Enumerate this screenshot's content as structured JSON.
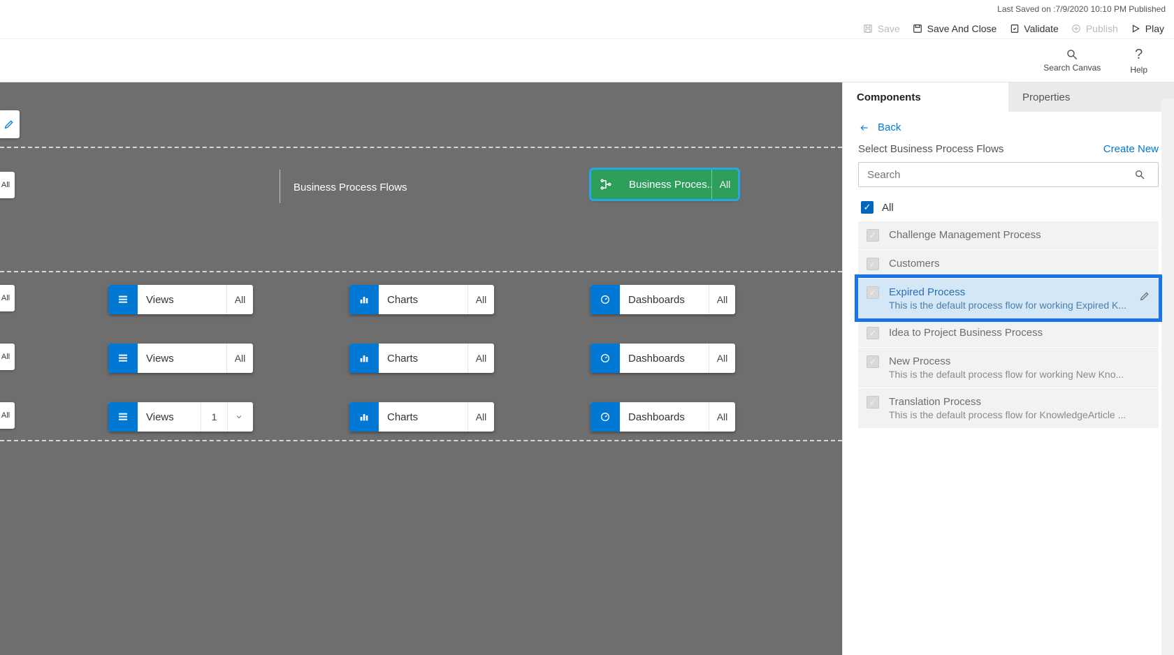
{
  "status": {
    "last_saved": "Last Saved on :7/9/2020 10:10 PM Published"
  },
  "toolbar": {
    "save": "Save",
    "save_close": "Save And Close",
    "validate": "Validate",
    "publish": "Publish",
    "play": "Play"
  },
  "secbar": {
    "search": "Search Canvas",
    "help": "Help"
  },
  "canvas": {
    "bpf_section_label": "Business Process Flows",
    "selected_tile": {
      "label": "Business Proces...",
      "badge": "All"
    },
    "lane_chip": "All",
    "rows": [
      [
        {
          "icon": "grid",
          "label": "Views",
          "badge": "All"
        },
        {
          "icon": "bar",
          "label": "Charts",
          "badge": "All"
        },
        {
          "icon": "gauge",
          "label": "Dashboards",
          "badge": "All"
        }
      ],
      [
        {
          "icon": "grid",
          "label": "Views",
          "badge": "All"
        },
        {
          "icon": "bar",
          "label": "Charts",
          "badge": "All"
        },
        {
          "icon": "gauge",
          "label": "Dashboards",
          "badge": "All"
        }
      ],
      [
        {
          "icon": "grid",
          "label": "Views",
          "badge": "1",
          "chev": true
        },
        {
          "icon": "bar",
          "label": "Charts",
          "badge": "All"
        },
        {
          "icon": "gauge",
          "label": "Dashboards",
          "badge": "All"
        }
      ]
    ]
  },
  "panel": {
    "tabs": {
      "components": "Components",
      "properties": "Properties"
    },
    "back": "Back",
    "title": "Select Business Process Flows",
    "create_new": "Create New",
    "search_placeholder": "Search",
    "all_label": "All",
    "items": [
      {
        "name": "Challenge Management Process"
      },
      {
        "name": "Customers"
      },
      {
        "name": "Expired Process",
        "desc": "This is the default process flow for working Expired K...",
        "highlight": true
      },
      {
        "name": "Idea to Project Business Process"
      },
      {
        "name": "New Process",
        "desc": "This is the default process flow for working New Kno..."
      },
      {
        "name": "Translation Process",
        "desc": "This is the default process flow for KnowledgeArticle ..."
      }
    ]
  }
}
